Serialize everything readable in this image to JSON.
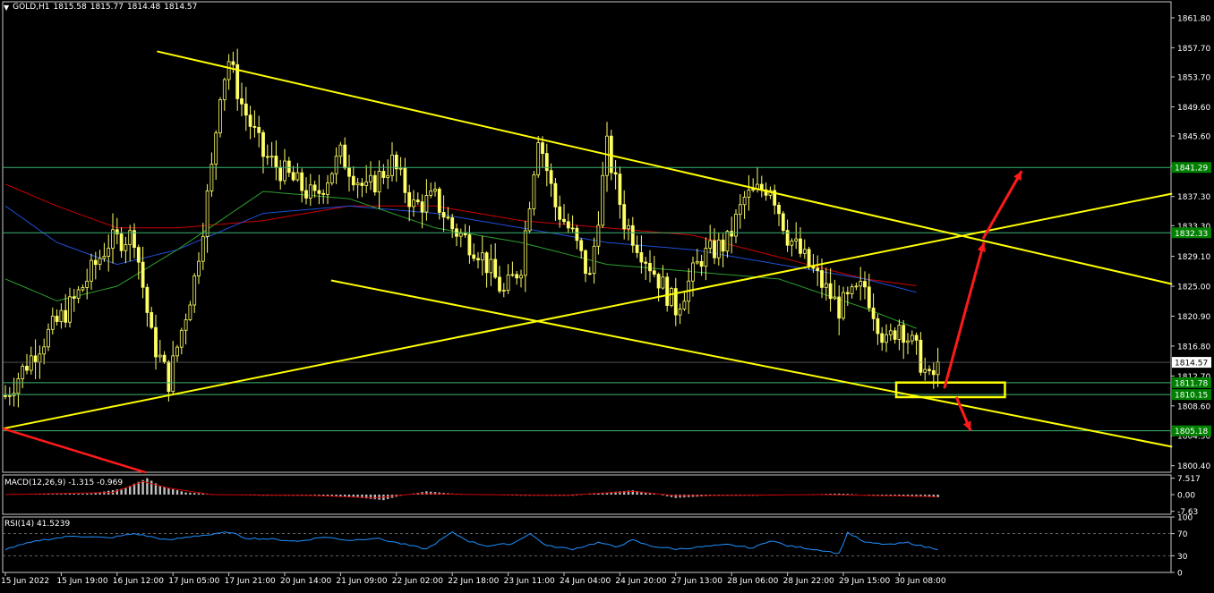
{
  "header": {
    "menu_icon": "triangle-down-icon",
    "symbol": "GOLD,H1",
    "open": "1815.58",
    "high": "1815.77",
    "low": "1814.48",
    "close": "1814.57"
  },
  "colors": {
    "background": "#000000",
    "candles": "#ffff66",
    "trendlines": "#ffff00",
    "levels": "#3cb371",
    "arrows": "#ff1a1a",
    "ma_red": "#cc0000",
    "ma_blue": "#1f4fd8",
    "ma_green": "#2e9e2e",
    "macd_hist": "#c0c0c0",
    "macd_signal": "#cc0000",
    "rsi_line": "#1e90ff",
    "price_label": "#008000"
  },
  "chart_data": {
    "type": "candlestick",
    "symbol": "GOLD",
    "timeframe": "H1",
    "ylim": [
      1799.5,
      1864.0
    ],
    "y_ticks": [
      "1861.80",
      "1857.70",
      "1853.70",
      "1849.60",
      "1845.60",
      "1841.50",
      "1837.30",
      "1833.30",
      "1829.10",
      "1825.00",
      "1820.90",
      "1816.80",
      "1812.70",
      "1808.60",
      "1804.50",
      "1800.40"
    ],
    "x_ticks": [
      "15 Jun 2022",
      "15 Jun 19:00",
      "16 Jun 12:00",
      "17 Jun 05:00",
      "17 Jun 21:00",
      "20 Jun 14:00",
      "21 Jun 09:00",
      "22 Jun 02:00",
      "22 Jun 18:00",
      "23 Jun 11:00",
      "24 Jun 04:00",
      "24 Jun 20:00",
      "27 Jun 13:00",
      "28 Jun 06:00",
      "28 Jun 22:00",
      "29 Jun 15:00",
      "30 Jun 08:00"
    ],
    "bars": 218,
    "price_path": [
      [
        0,
        1810
      ],
      [
        8,
        1817
      ],
      [
        16,
        1823
      ],
      [
        24,
        1831
      ],
      [
        30,
        1832
      ],
      [
        34,
        1818
      ],
      [
        38,
        1812
      ],
      [
        44,
        1826
      ],
      [
        48,
        1841
      ],
      [
        50,
        1852
      ],
      [
        52,
        1856
      ],
      [
        55,
        1850
      ],
      [
        60,
        1843
      ],
      [
        66,
        1840
      ],
      [
        72,
        1837
      ],
      [
        78,
        1843
      ],
      [
        84,
        1838
      ],
      [
        90,
        1842
      ],
      [
        95,
        1836
      ],
      [
        100,
        1837
      ],
      [
        104,
        1833
      ],
      [
        110,
        1830
      ],
      [
        116,
        1824
      ],
      [
        120,
        1828
      ],
      [
        124,
        1846
      ],
      [
        128,
        1836
      ],
      [
        132,
        1832
      ],
      [
        136,
        1826
      ],
      [
        140,
        1844
      ],
      [
        144,
        1834
      ],
      [
        150,
        1828
      ],
      [
        156,
        1822
      ],
      [
        162,
        1829
      ],
      [
        168,
        1831
      ],
      [
        172,
        1837
      ],
      [
        178,
        1839
      ],
      [
        182,
        1832
      ],
      [
        188,
        1827
      ],
      [
        194,
        1822
      ],
      [
        200,
        1825
      ],
      [
        205,
        1817
      ],
      [
        208,
        1820
      ],
      [
        212,
        1816
      ],
      [
        215,
        1812
      ],
      [
        218,
        1814.57
      ]
    ],
    "ma_red": [
      [
        0,
        1839
      ],
      [
        12,
        1836
      ],
      [
        26,
        1833
      ],
      [
        40,
        1833
      ],
      [
        60,
        1834
      ],
      [
        80,
        1836
      ],
      [
        100,
        1836
      ],
      [
        120,
        1834
      ],
      [
        140,
        1833
      ],
      [
        160,
        1832
      ],
      [
        180,
        1829
      ],
      [
        200,
        1826
      ],
      [
        213,
        1825
      ]
    ],
    "ma_blue": [
      [
        0,
        1836
      ],
      [
        12,
        1831
      ],
      [
        26,
        1828
      ],
      [
        40,
        1830
      ],
      [
        60,
        1835
      ],
      [
        80,
        1836
      ],
      [
        100,
        1835
      ],
      [
        120,
        1833
      ],
      [
        140,
        1831
      ],
      [
        160,
        1830
      ],
      [
        180,
        1828
      ],
      [
        200,
        1826
      ],
      [
        213,
        1824
      ]
    ],
    "ma_green": [
      [
        0,
        1826
      ],
      [
        12,
        1823
      ],
      [
        26,
        1825
      ],
      [
        40,
        1830
      ],
      [
        60,
        1838
      ],
      [
        80,
        1837
      ],
      [
        100,
        1833
      ],
      [
        120,
        1831
      ],
      [
        140,
        1828
      ],
      [
        160,
        1827
      ],
      [
        180,
        1826
      ],
      [
        200,
        1822
      ],
      [
        213,
        1819
      ]
    ],
    "levels": [
      {
        "price": 1841.29,
        "label": "1841.29"
      },
      {
        "price": 1832.33,
        "label": "1832.33"
      },
      {
        "price": 1811.78,
        "label": "1811.78"
      },
      {
        "price": 1810.15,
        "label": "1810.15"
      },
      {
        "price": 1805.18,
        "label": "1805.18"
      }
    ],
    "current_price": {
      "price": 1814.57,
      "label": "1814.57"
    }
  },
  "macd": {
    "label": "MACD(12,26,9) -1.315 -0.969",
    "y_ticks": [
      "7.517",
      "0.00",
      "-7.63"
    ],
    "ylim": [
      -9,
      9
    ],
    "hist_path": [
      [
        0,
        0
      ],
      [
        20,
        0.5
      ],
      [
        28,
        3
      ],
      [
        30,
        5
      ],
      [
        33,
        7.5
      ],
      [
        36,
        4
      ],
      [
        42,
        1
      ],
      [
        50,
        0
      ],
      [
        60,
        -0.5
      ],
      [
        70,
        -0.5
      ],
      [
        80,
        -1
      ],
      [
        88,
        -2.5
      ],
      [
        92,
        -0.5
      ],
      [
        98,
        1.5
      ],
      [
        104,
        0.5
      ],
      [
        110,
        0
      ],
      [
        120,
        -0.5
      ],
      [
        132,
        -0.5
      ],
      [
        140,
        1
      ],
      [
        146,
        2
      ],
      [
        152,
        0
      ],
      [
        156,
        -1.5
      ],
      [
        165,
        -0.5
      ],
      [
        175,
        -0.5
      ],
      [
        185,
        0
      ],
      [
        194,
        0.5
      ],
      [
        202,
        -0.3
      ],
      [
        218,
        -1.3
      ]
    ],
    "signal_path": [
      [
        0,
        0
      ],
      [
        25,
        1
      ],
      [
        32,
        6
      ],
      [
        38,
        3
      ],
      [
        48,
        0
      ],
      [
        70,
        -0.3
      ],
      [
        86,
        -1.5
      ],
      [
        96,
        0.5
      ],
      [
        110,
        0
      ],
      [
        130,
        -0.3
      ],
      [
        146,
        1.5
      ],
      [
        156,
        -0.5
      ],
      [
        190,
        0
      ],
      [
        218,
        -0.97
      ]
    ]
  },
  "rsi": {
    "label": "RSI(14) 41.5239",
    "y_ticks": [
      "100",
      "70",
      "30",
      "0"
    ],
    "path": [
      [
        0,
        42
      ],
      [
        8,
        58
      ],
      [
        16,
        66
      ],
      [
        24,
        62
      ],
      [
        30,
        70
      ],
      [
        34,
        64
      ],
      [
        38,
        58
      ],
      [
        44,
        66
      ],
      [
        48,
        68
      ],
      [
        52,
        73
      ],
      [
        56,
        62
      ],
      [
        62,
        60
      ],
      [
        68,
        56
      ],
      [
        74,
        64
      ],
      [
        80,
        58
      ],
      [
        86,
        62
      ],
      [
        92,
        52
      ],
      [
        98,
        42
      ],
      [
        100,
        52
      ],
      [
        104,
        72
      ],
      [
        108,
        56
      ],
      [
        112,
        48
      ],
      [
        118,
        52
      ],
      [
        122,
        70
      ],
      [
        126,
        48
      ],
      [
        132,
        42
      ],
      [
        138,
        54
      ],
      [
        142,
        46
      ],
      [
        146,
        58
      ],
      [
        150,
        48
      ],
      [
        156,
        42
      ],
      [
        162,
        46
      ],
      [
        168,
        50
      ],
      [
        174,
        44
      ],
      [
        178,
        58
      ],
      [
        182,
        48
      ],
      [
        190,
        40
      ],
      [
        194,
        34
      ],
      [
        196,
        72
      ],
      [
        200,
        54
      ],
      [
        206,
        50
      ],
      [
        210,
        54
      ],
      [
        214,
        46
      ],
      [
        218,
        41.5
      ]
    ]
  }
}
